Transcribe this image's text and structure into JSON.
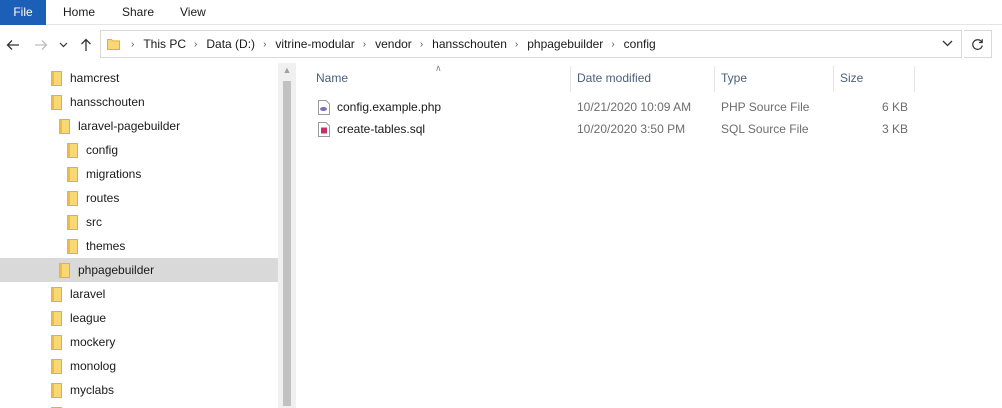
{
  "ribbon": {
    "tabs": [
      {
        "label": "File",
        "active": true
      },
      {
        "label": "Home"
      },
      {
        "label": "Share"
      },
      {
        "label": "View"
      }
    ],
    "accent": "#1c5fb7"
  },
  "address_bar": {
    "breadcrumbs": [
      "This PC",
      "Data (D:)",
      "vitrine-modular",
      "vendor",
      "hansschouten",
      "phpagebuilder",
      "config"
    ]
  },
  "nav_tree": {
    "items": [
      {
        "label": "hamcrest",
        "level": 0
      },
      {
        "label": "hansschouten",
        "level": 0
      },
      {
        "label": "laravel-pagebuilder",
        "level": 1
      },
      {
        "label": "config",
        "level": 2
      },
      {
        "label": "migrations",
        "level": 2
      },
      {
        "label": "routes",
        "level": 2
      },
      {
        "label": "src",
        "level": 2
      },
      {
        "label": "themes",
        "level": 2
      },
      {
        "label": "phpagebuilder",
        "level": 1,
        "selected": true
      },
      {
        "label": "laravel",
        "level": 0
      },
      {
        "label": "league",
        "level": 0
      },
      {
        "label": "mockery",
        "level": 0
      },
      {
        "label": "monolog",
        "level": 0
      },
      {
        "label": "myclabs",
        "level": 0
      }
    ]
  },
  "file_list": {
    "columns": {
      "name": "Name",
      "date": "Date modified",
      "type": "Type",
      "size": "Size"
    },
    "sorted_by": "name",
    "rows": [
      {
        "name": "config.example.php",
        "date": "10/21/2020 10:09 AM",
        "type": "PHP Source File",
        "size": "6 KB",
        "icon": "php-file-icon"
      },
      {
        "name": "create-tables.sql",
        "date": "10/20/2020 3:50 PM",
        "type": "SQL Source File",
        "size": "3 KB",
        "icon": "sql-file-icon"
      }
    ]
  },
  "colors": {
    "folder": "#f8d775",
    "folder_dark": "#e0b03c",
    "selection": "#d9d9d9",
    "header_text": "#4c607a"
  }
}
